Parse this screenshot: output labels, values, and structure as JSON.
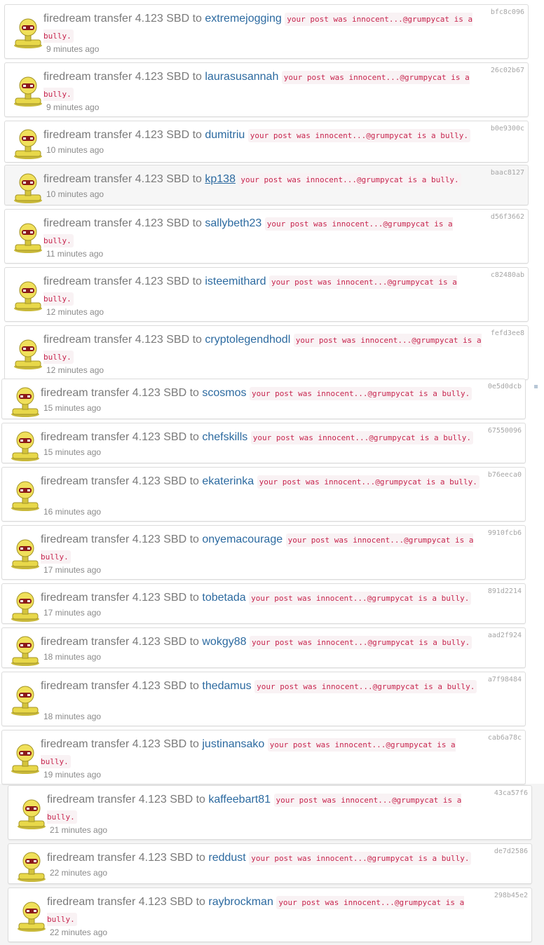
{
  "transfers": [
    {
      "sender": "firedream",
      "verb": "transfer",
      "amount": "4.123 SBD",
      "to": "to",
      "recipient": "extremejogging",
      "memo": "your post was innocent...@grumpycat is a bully.",
      "time": "9 minutes ago",
      "hash": "bfc8c096"
    },
    {
      "sender": "firedream",
      "verb": "transfer",
      "amount": "4.123 SBD",
      "to": "to",
      "recipient": "laurasusannah",
      "memo": "your post was innocent...@grumpycat is a bully.",
      "time": "9 minutes ago",
      "hash": "26c02b67"
    },
    {
      "sender": "firedream",
      "verb": "transfer",
      "amount": "4.123 SBD",
      "to": "to",
      "recipient": "dumitriu",
      "memo": "your post was innocent...@grumpycat is a bully.",
      "time": "10 minutes ago",
      "hash": "b0e9300c"
    },
    {
      "sender": "firedream",
      "verb": "transfer",
      "amount": "4.123 SBD",
      "to": "to",
      "recipient": "kp138",
      "memo": "your post was innocent...@grumpycat is a bully.",
      "time": "10 minutes ago",
      "hash": "baac8127"
    },
    {
      "sender": "firedream",
      "verb": "transfer",
      "amount": "4.123 SBD",
      "to": "to",
      "recipient": "sallybeth23",
      "memo": "your post was innocent...@grumpycat is a bully.",
      "time": "11 minutes ago",
      "hash": "d56f3662"
    },
    {
      "sender": "firedream",
      "verb": "transfer",
      "amount": "4.123 SBD",
      "to": "to",
      "recipient": "isteemithard",
      "memo": "your post was innocent...@grumpycat is a bully.",
      "time": "12 minutes ago",
      "hash": "c82480ab"
    },
    {
      "sender": "firedream",
      "verb": "transfer",
      "amount": "4.123 SBD",
      "to": "to",
      "recipient": "cryptolegendhodl",
      "memo": "your post was innocent...@grumpycat is a bully.",
      "time": "12 minutes ago",
      "hash": "fefd3ee8"
    },
    {
      "sender": "firedream",
      "verb": "transfer",
      "amount": "4.123 SBD",
      "to": "to",
      "recipient": "scosmos",
      "memo": "your post was innocent...@grumpycat is a bully.",
      "time": "15 minutes ago",
      "hash": "0e5d0dcb"
    },
    {
      "sender": "firedream",
      "verb": "transfer",
      "amount": "4.123 SBD",
      "to": "to",
      "recipient": "chefskills",
      "memo": "your post was innocent...@grumpycat is a bully.",
      "time": "15 minutes ago",
      "hash": "67550096"
    },
    {
      "sender": "firedream",
      "verb": "transfer",
      "amount": "4.123 SBD",
      "to": "to",
      "recipient": "ekaterinka",
      "memo": "your post was innocent...@grumpycat is a bully.",
      "time": "16 minutes ago",
      "hash": "b76eeca0"
    },
    {
      "sender": "firedream",
      "verb": "transfer",
      "amount": "4.123 SBD",
      "to": "to",
      "recipient": "onyemacourage",
      "memo": "your post was innocent...@grumpycat is a bully.",
      "time": "17 minutes ago",
      "hash": "9910fcb6"
    },
    {
      "sender": "firedream",
      "verb": "transfer",
      "amount": "4.123 SBD",
      "to": "to",
      "recipient": "tobetada",
      "memo": "your post was innocent...@grumpycat is a bully.",
      "time": "17 minutes ago",
      "hash": "891d2214"
    },
    {
      "sender": "firedream",
      "verb": "transfer",
      "amount": "4.123 SBD",
      "to": "to",
      "recipient": "wokgy88",
      "memo": "your post was innocent...@grumpycat is a bully.",
      "time": "18 minutes ago",
      "hash": "aad2f924"
    },
    {
      "sender": "firedream",
      "verb": "transfer",
      "amount": "4.123 SBD",
      "to": "to",
      "recipient": "thedamus",
      "memo": "your post was innocent...@grumpycat is a bully.",
      "time": "18 minutes ago",
      "hash": "a7f98484"
    },
    {
      "sender": "firedream",
      "verb": "transfer",
      "amount": "4.123 SBD",
      "to": "to",
      "recipient": "justinansako",
      "memo": "your post was innocent...@grumpycat is a bully.",
      "time": "19 minutes ago",
      "hash": "cab6a78c"
    },
    {
      "sender": "firedream",
      "verb": "transfer",
      "amount": "4.123 SBD",
      "to": "to",
      "recipient": "kaffeebart81",
      "memo": "your post was innocent...@grumpycat is a bully.",
      "time": "21 minutes ago",
      "hash": "43ca57f6"
    },
    {
      "sender": "firedream",
      "verb": "transfer",
      "amount": "4.123 SBD",
      "to": "to",
      "recipient": "reddust",
      "memo": "your post was innocent...@grumpycat is a bully.",
      "time": "22 minutes ago",
      "hash": "de7d2586"
    },
    {
      "sender": "firedream",
      "verb": "transfer",
      "amount": "4.123 SBD",
      "to": "to",
      "recipient": "raybrockman",
      "memo": "your post was innocent...@grumpycat is a bully.",
      "time": "22 minutes ago",
      "hash": "298b45e2"
    }
  ],
  "avatar_icon": "robot-avatar-icon",
  "colors": {
    "link": "#2c6aa0",
    "memo_text": "#c7254e",
    "memo_bg": "#f9f2f4",
    "avatar_body": "#e8d84a",
    "avatar_visor": "#8b1a1a"
  }
}
